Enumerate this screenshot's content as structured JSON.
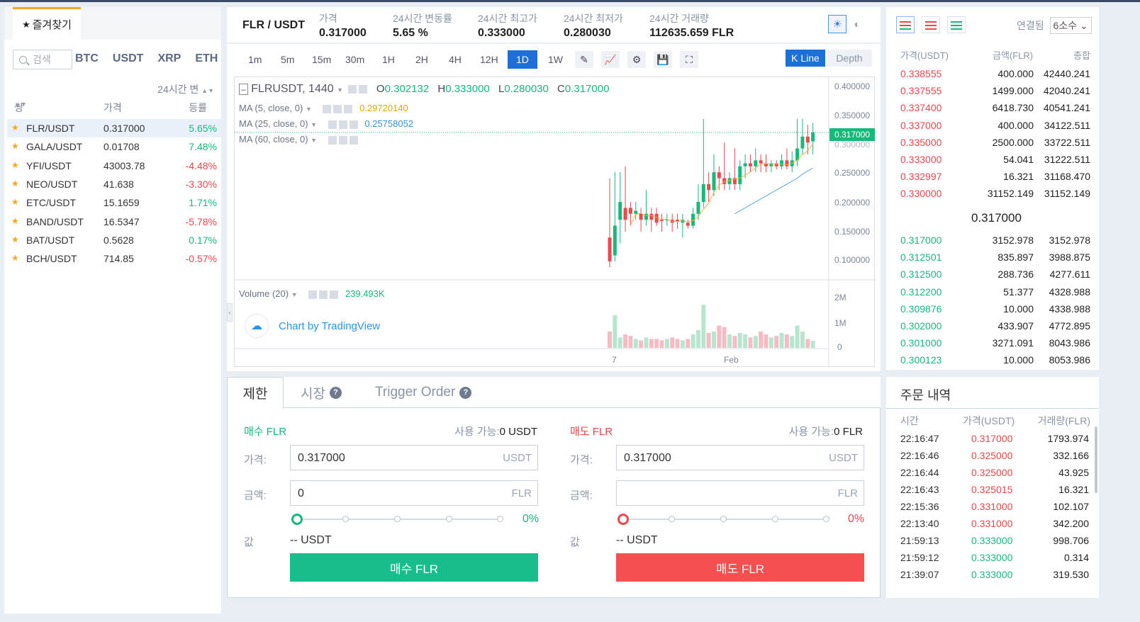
{
  "left": {
    "favorites_tab": "즐겨찾기",
    "search_placeholder": "검색",
    "markets": [
      "BTC",
      "USDT",
      "XRP",
      "ETH"
    ],
    "change_header": "24시간 변",
    "columns": [
      "쌍",
      "가격",
      "등률"
    ],
    "coins": [
      {
        "pair": "FLR/USDT",
        "price": "0.317000",
        "change": "5.65%",
        "dir": "up"
      },
      {
        "pair": "GALA/USDT",
        "price": "0.01708",
        "change": "7.48%",
        "dir": "up"
      },
      {
        "pair": "YFI/USDT",
        "price": "43003.78",
        "change": "-4.48%",
        "dir": "down"
      },
      {
        "pair": "NEO/USDT",
        "price": "41.638",
        "change": "-3.30%",
        "dir": "down"
      },
      {
        "pair": "ETC/USDT",
        "price": "15.1659",
        "change": "1.71%",
        "dir": "up"
      },
      {
        "pair": "BAND/USDT",
        "price": "16.5347",
        "change": "-5.78%",
        "dir": "down"
      },
      {
        "pair": "BAT/USDT",
        "price": "0.5628",
        "change": "0.17%",
        "dir": "up"
      },
      {
        "pair": "BCH/USDT",
        "price": "714.85",
        "change": "-0.57%",
        "dir": "down"
      }
    ]
  },
  "header": {
    "pair": "FLR / USDT",
    "stats": [
      {
        "label": "가격",
        "value": "0.317000",
        "color": "dark"
      },
      {
        "label": "24시간 변동률",
        "value": "5.65 %",
        "color": "green"
      },
      {
        "label": "24시간 최고가",
        "value": "0.333000",
        "color": "dark"
      },
      {
        "label": "24시간 최저가",
        "value": "0.280030",
        "color": "dark"
      },
      {
        "label": "24시간 거래량",
        "value": "112635.659 FLR",
        "color": "dark"
      }
    ],
    "theme_light_icon": "sun-icon",
    "theme_dark_icon": "moon-icon"
  },
  "chart": {
    "timeframes": [
      "1m",
      "5m",
      "15m",
      "30m",
      "1H",
      "2H",
      "4H",
      "12H",
      "1D",
      "1W"
    ],
    "active_timeframe": "1D",
    "kline_label": "K Line",
    "depth_label": "Depth",
    "symbol": "FLRUSDT, 1440",
    "ohlc": {
      "O": "0.302132",
      "H": "0.333000",
      "L": "0.280030",
      "C": "0.317000"
    },
    "ma_lines": [
      {
        "label": "MA (5, close, 0)",
        "value": "0.29720140",
        "color": "#e6a700"
      },
      {
        "label": "MA (25, close, 0)",
        "value": "0.25758052",
        "color": "#3a8fd8"
      },
      {
        "label": "MA (60, close, 0)",
        "value": "",
        "color": "#888888"
      }
    ],
    "volume_label": "Volume (20)",
    "volume_value": "239.493K",
    "tv_label": "Chart by TradingView",
    "last_price_tag": "0.317000",
    "y_ticks": [
      "0.400000",
      "0.350000",
      "0.300000",
      "0.250000",
      "0.200000",
      "0.150000",
      "0.100000"
    ],
    "vol_ticks": [
      "2M",
      "1M",
      "0"
    ],
    "x_ticks": [
      "7",
      "Feb"
    ]
  },
  "chart_data": {
    "type": "candlestick",
    "symbol": "FLRUSDT",
    "interval": "1440",
    "ylim": [
      0.07,
      0.41
    ],
    "candles": [
      [
        0.14,
        0.1,
        0.09,
        0.24
      ],
      [
        0.11,
        0.16,
        0.1,
        0.25
      ],
      [
        0.17,
        0.2,
        0.13,
        0.25
      ],
      [
        0.19,
        0.17,
        0.15,
        0.26
      ],
      [
        0.19,
        0.18,
        0.16,
        0.2
      ],
      [
        0.18,
        0.185,
        0.17,
        0.2
      ],
      [
        0.18,
        0.17,
        0.15,
        0.19
      ],
      [
        0.17,
        0.18,
        0.16,
        0.22
      ],
      [
        0.18,
        0.17,
        0.15,
        0.19
      ],
      [
        0.18,
        0.165,
        0.16,
        0.19
      ],
      [
        0.17,
        0.168,
        0.15,
        0.18
      ],
      [
        0.17,
        0.17,
        0.16,
        0.18
      ],
      [
        0.17,
        0.165,
        0.15,
        0.18
      ],
      [
        0.17,
        0.167,
        0.155,
        0.18
      ],
      [
        0.165,
        0.17,
        0.14,
        0.18
      ],
      [
        0.165,
        0.16,
        0.155,
        0.17
      ],
      [
        0.16,
        0.18,
        0.155,
        0.19
      ],
      [
        0.18,
        0.2,
        0.17,
        0.23
      ],
      [
        0.2,
        0.23,
        0.19,
        0.34
      ],
      [
        0.23,
        0.22,
        0.2,
        0.25
      ],
      [
        0.22,
        0.25,
        0.21,
        0.28
      ],
      [
        0.25,
        0.24,
        0.22,
        0.26
      ],
      [
        0.24,
        0.23,
        0.22,
        0.3
      ],
      [
        0.23,
        0.24,
        0.22,
        0.25
      ],
      [
        0.24,
        0.23,
        0.22,
        0.29
      ],
      [
        0.23,
        0.26,
        0.22,
        0.27
      ],
      [
        0.26,
        0.265,
        0.24,
        0.28
      ],
      [
        0.265,
        0.26,
        0.25,
        0.28
      ],
      [
        0.26,
        0.27,
        0.25,
        0.29
      ],
      [
        0.27,
        0.265,
        0.25,
        0.28
      ],
      [
        0.265,
        0.26,
        0.25,
        0.28
      ],
      [
        0.26,
        0.265,
        0.25,
        0.27
      ],
      [
        0.265,
        0.26,
        0.255,
        0.27
      ],
      [
        0.26,
        0.27,
        0.255,
        0.28
      ],
      [
        0.27,
        0.26,
        0.255,
        0.29
      ],
      [
        0.26,
        0.27,
        0.25,
        0.285
      ],
      [
        0.27,
        0.29,
        0.26,
        0.34
      ],
      [
        0.29,
        0.31,
        0.28,
        0.34
      ],
      [
        0.31,
        0.3,
        0.28,
        0.33
      ],
      [
        0.302,
        0.317,
        0.28,
        0.333
      ]
    ],
    "volumes": [
      0.55,
      1.1,
      0.35,
      0.45,
      0.4,
      0.3,
      0.25,
      0.35,
      0.3,
      0.3,
      0.25,
      0.3,
      0.35,
      0.3,
      0.25,
      0.3,
      0.45,
      0.6,
      1.45,
      0.5,
      0.55,
      0.75,
      0.7,
      0.45,
      0.4,
      0.5,
      0.45,
      0.35,
      0.4,
      0.55,
      0.45,
      0.35,
      0.4,
      0.5,
      0.45,
      0.4,
      0.75,
      0.55,
      0.3,
      0.24
    ],
    "ma25": [
      0.18,
      0.185,
      0.19,
      0.195,
      0.2,
      0.205,
      0.21,
      0.215,
      0.22,
      0.225,
      0.23,
      0.235,
      0.24,
      0.247,
      0.252,
      0.257
    ],
    "last_price": 0.317
  },
  "order": {
    "tabs": [
      "제한",
      "시장",
      "Trigger Order"
    ],
    "buy": {
      "title": "매수 FLR",
      "avail_label": "사용 가능:",
      "avail_value": "0 USDT",
      "price_label": "가격:",
      "price_value": "0.317000",
      "price_unit": "USDT",
      "amount_label": "금액:",
      "amount_value": "0",
      "amount_unit": "FLR",
      "pct": "0%",
      "value_label": "값",
      "value_text": "-- USDT",
      "button": "매수 FLR"
    },
    "sell": {
      "title": "매도 FLR",
      "avail_label": "사용 가능:",
      "avail_value": "0 FLR",
      "price_label": "가격:",
      "price_value": "0.317000",
      "price_unit": "USDT",
      "amount_label": "금액:",
      "amount_value": "",
      "amount_unit": "FLR",
      "pct": "0%",
      "value_label": "값",
      "value_text": "-- USDT",
      "button": "매도 FLR"
    }
  },
  "book": {
    "decimal_label": "연결됨",
    "decimal_value": "6소수",
    "headers": [
      "가격(USDT)",
      "금액(FLR)",
      "총합"
    ],
    "asks": [
      [
        "0.338555",
        "400.000",
        "42440.241"
      ],
      [
        "0.337555",
        "1499.000",
        "42040.241"
      ],
      [
        "0.337400",
        "6418.730",
        "40541.241"
      ],
      [
        "0.337000",
        "400.000",
        "34122.511"
      ],
      [
        "0.335000",
        "2500.000",
        "33722.511"
      ],
      [
        "0.333000",
        "54.041",
        "31222.511"
      ],
      [
        "0.332997",
        "16.321",
        "31168.470"
      ],
      [
        "0.330000",
        "31152.149",
        "31152.149"
      ]
    ],
    "mid": "0.317000",
    "bids": [
      [
        "0.317000",
        "3152.978",
        "3152.978"
      ],
      [
        "0.312501",
        "835.897",
        "3988.875"
      ],
      [
        "0.312500",
        "288.736",
        "4277.611"
      ],
      [
        "0.312200",
        "51.377",
        "4328.988"
      ],
      [
        "0.309876",
        "10.000",
        "4338.988"
      ],
      [
        "0.302000",
        "433.907",
        "4772.895"
      ],
      [
        "0.301000",
        "3271.091",
        "8043.986"
      ],
      [
        "0.300123",
        "10.000",
        "8053.986"
      ]
    ]
  },
  "trades": {
    "title": "주문 내역",
    "headers": [
      "시간",
      "가격(USDT)",
      "거래량(FLR)"
    ],
    "rows": [
      [
        "22:16:47",
        "0.317000",
        "1793.974",
        "down"
      ],
      [
        "22:16:46",
        "0.325000",
        "332.166",
        "down"
      ],
      [
        "22:16:44",
        "0.325000",
        "43.925",
        "down"
      ],
      [
        "22:16:43",
        "0.325015",
        "16.321",
        "down"
      ],
      [
        "22:15:36",
        "0.331000",
        "102.107",
        "down"
      ],
      [
        "22:13:40",
        "0.331000",
        "342.200",
        "down"
      ],
      [
        "21:59:13",
        "0.333000",
        "998.706",
        "up"
      ],
      [
        "21:59:12",
        "0.333000",
        "0.314",
        "up"
      ],
      [
        "21:39:07",
        "0.333000",
        "319.530",
        "up"
      ]
    ]
  }
}
